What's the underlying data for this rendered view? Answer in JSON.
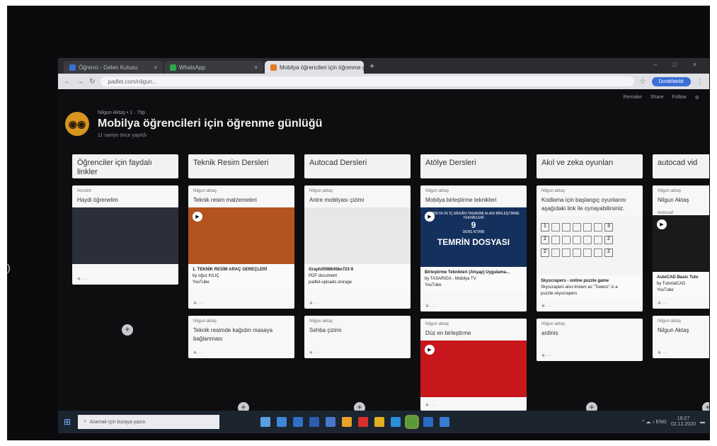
{
  "browser": {
    "tabs": [
      {
        "label": "Öğrenci - Gelen Kutusu",
        "favicon_color": "#3b6fd6",
        "active": false
      },
      {
        "label": "WhatsApp",
        "favicon_color": "#2ba84a",
        "active": false
      },
      {
        "label": "Mobilya öğrencileri için öğrenme günlüğü",
        "favicon_color": "#e27b1d",
        "active": true
      }
    ],
    "newtab": "+",
    "window_controls": "– □ ×",
    "url": "padlet.com/nilgun...",
    "account_label": "Duraklatıldı"
  },
  "padlet": {
    "topright": [
      "Remake",
      "Share",
      "Follow",
      "⚙"
    ],
    "owner_line": "Nilgun Aktaş  • 1 ·  79p",
    "title": "Mobilya öğrencileri için öğrenme günlüğü",
    "subtitle": "11 saniye önce yapıldı",
    "avatar_glyph": "◉◉",
    "columns": [
      {
        "heading": "Öğrenciler  için faydalı linkler",
        "cards": [
          {
            "meta": "Anonim",
            "title": "Haydi öğrenelim",
            "has_media": true,
            "media_color": "#2b2f3a"
          }
        ]
      },
      {
        "heading": "Teknik Resim Dersleri",
        "cards": [
          {
            "meta": "Nilgun aktaş",
            "title": "Teknik resim malzemeleri",
            "has_media": true,
            "media_color": "#b3541e",
            "caption_title": "1. TEKNİK RESİM ARAÇ GEREÇLERİ",
            "caption_by": "by oğuz KILIÇ",
            "caption_src": "YouTube"
          },
          {
            "meta": "Nilgun aktaş",
            "title": "Teknik resimde kağıdın masaya bağlanması"
          }
        ]
      },
      {
        "heading": "Autocad Dersleri",
        "cards": [
          {
            "meta": "Nilgun aktaş",
            "title": "Antre mobilyası çizimi",
            "has_media": true,
            "media_color": "#e6e7e9",
            "caption_title": "Graph20986456e723-9",
            "caption_by": "PDF document",
            "caption_src": "padlet-uploads.storage"
          },
          {
            "meta": "Nilgun aktaş",
            "title": "Sehba çizimi"
          }
        ]
      },
      {
        "heading": "Atölye Dersleri",
        "cards": [
          {
            "meta": "Nilgun aktaş",
            "title": "Mobilya birleştirme teknikleri",
            "has_media": true,
            "media_color": "#14305c",
            "banner_top": "MOBİLYA VE İÇ MEKÂN TASARIMI ALANI BİRLEŞTİRME TEKNİKLERİ",
            "banner_num": "9",
            "banner_mid": "DERS KİTABI",
            "banner_big": "TEMRİN DOSYASI",
            "caption_title": "Birleştirme Teknikleri (Ahşap) Uygulama...",
            "caption_by": "by TASARIGA - Mobilya TV",
            "caption_src": "YouTube"
          },
          {
            "meta": "Nilgun aktaş",
            "title": "Düz en birleştirme",
            "has_media": true,
            "media_color": "#c8161d"
          }
        ]
      },
      {
        "heading": "Akıl ve zeka oyunları",
        "cards": [
          {
            "meta": "Nilgun aktaş",
            "title": "Kodlama için başlangıç oyunlarını aşağıdaki link ile oynayabilirsiniz.",
            "has_media": true,
            "media_color": "#f4f4f4",
            "puzzle_rows": [
              "1",
              "2",
              "2"
            ],
            "puzzle_ends": [
              "3",
              "2",
              "2"
            ],
            "caption_title": "Skyscrapers - online puzzle game",
            "caption_by": "Skyscrapers also known as \"Towers\" is a",
            "caption_src": "puzzle-skyscrapers"
          },
          {
            "meta": "Nilgun aktaş",
            "title": "ardinis"
          }
        ]
      },
      {
        "heading": "autocad vid",
        "cards": [
          {
            "meta": "Nilgun aktaş",
            "title": "Nilgun Aktaş",
            "subtitle": "Autocad",
            "has_media": true,
            "media_color": "#1a1a1a",
            "caption_title": "AutoCAD Basic Tuto",
            "caption_by": "by TutorialCAD",
            "caption_src": "YouTube"
          },
          {
            "meta": "Nilgun aktaş",
            "title": "Nilgun Aktaş"
          }
        ]
      }
    ],
    "add_symbol": "+"
  },
  "taskbar": {
    "search_placeholder": "Aramak için buraya yazın",
    "apps": [
      "#5aa0e0",
      "#3d86d8",
      "#2f6fc4",
      "#2a5fb0",
      "#4a78c8",
      "#e8a12b",
      "#d8302a",
      "#e0b020",
      "#2a8fd8",
      "#5a9a38",
      "#2b6cc2",
      "#3a7ad0"
    ],
    "tray_text": "^ ☁ ♪ ENG",
    "time": "18:27",
    "date": "02.12.2020"
  }
}
